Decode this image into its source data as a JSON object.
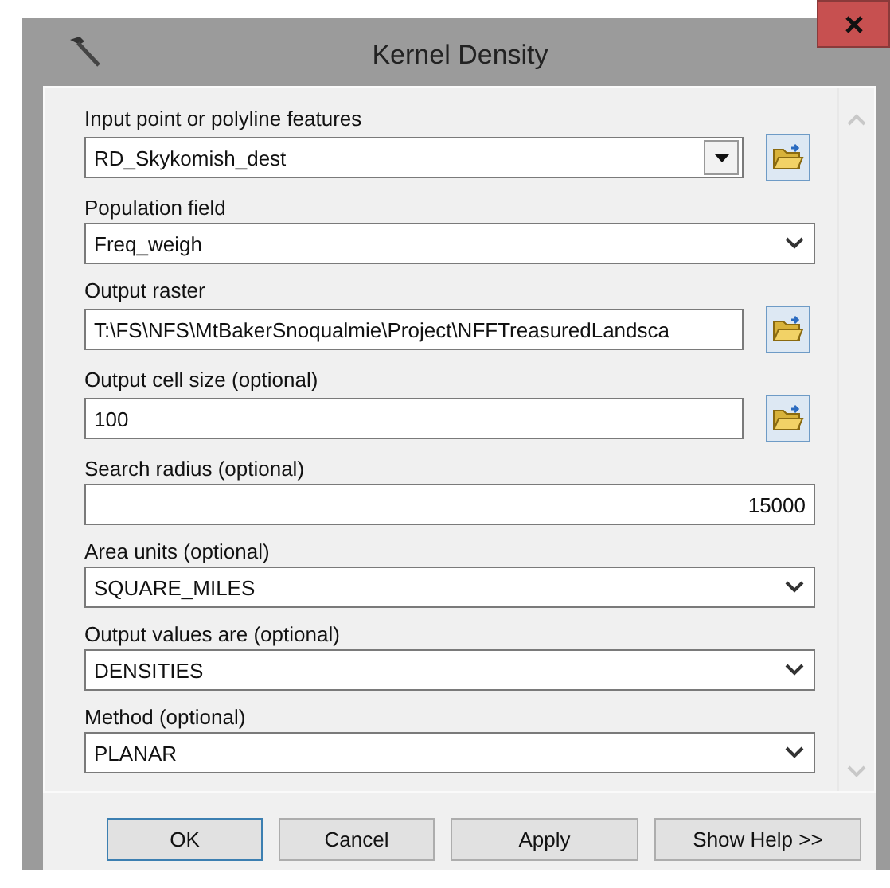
{
  "window": {
    "title": "Kernel Density"
  },
  "fields": [
    {
      "label": "Input point or polyline features",
      "kind": "combo",
      "value": "RD_Skykomish_dest",
      "browse": true
    },
    {
      "label": "Population field",
      "kind": "select",
      "value": "Freq_weigh",
      "browse": false
    },
    {
      "label": "Output raster",
      "kind": "text",
      "value": "T:\\FS\\NFS\\MtBakerSnoqualmie\\Project\\NFFTreasuredLandsca",
      "browse": true
    },
    {
      "label": "Output cell size (optional)",
      "kind": "text",
      "value": "100",
      "browse": true
    },
    {
      "label": "Search radius (optional)",
      "kind": "number",
      "value": "15000",
      "browse": false
    },
    {
      "label": "Area units (optional)",
      "kind": "select",
      "value": "SQUARE_MILES",
      "browse": false
    },
    {
      "label": "Output values are (optional)",
      "kind": "select",
      "value": "DENSITIES",
      "browse": false
    },
    {
      "label": "Method (optional)",
      "kind": "select",
      "value": "PLANAR",
      "browse": false
    }
  ],
  "buttons": [
    {
      "label": "OK",
      "default": true
    },
    {
      "label": "Cancel",
      "default": false
    },
    {
      "label": "Apply",
      "default": false
    },
    {
      "label": "Show Help >>",
      "default": false
    }
  ]
}
